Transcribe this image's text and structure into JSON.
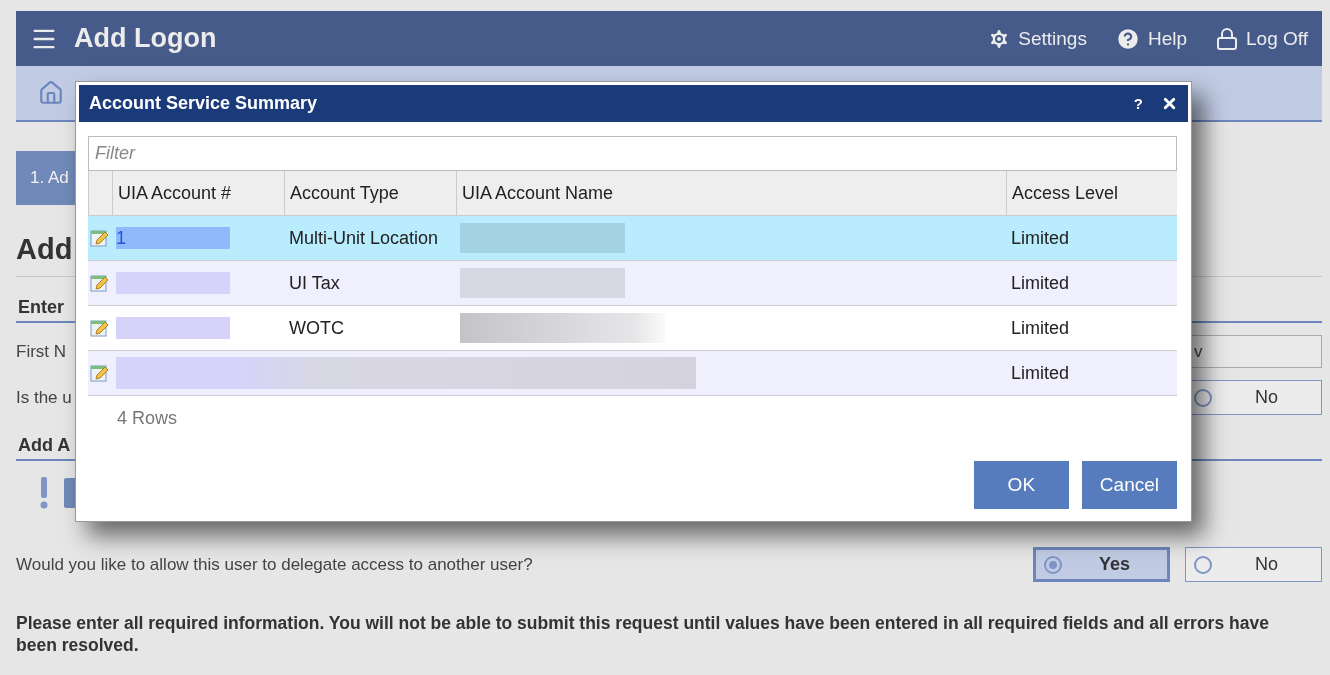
{
  "header": {
    "title": "Add Logon",
    "menu": [
      {
        "kind": "settings",
        "label": "Settings"
      },
      {
        "kind": "help",
        "label": "Help"
      },
      {
        "kind": "logoff",
        "label": "Log Off"
      }
    ]
  },
  "step": "1. Ad",
  "page": {
    "heading": "Add",
    "sections": [
      {
        "title": "Enter",
        "rows": [
          {
            "kind": "field",
            "label": "First N",
            "value": "v"
          },
          {
            "kind": "choice",
            "label": "Is the u",
            "options": [
              {
                "label": "No",
                "selected": false
              }
            ]
          }
        ]
      },
      {
        "title": "Add A",
        "rows": [
          {
            "kind": "alert"
          }
        ]
      }
    ],
    "delegate": {
      "question": "Would you like to allow this user to delegate access to another user?",
      "options": [
        {
          "label": "Yes",
          "selected": true
        },
        {
          "label": "No",
          "selected": false
        }
      ]
    },
    "notice": "Please enter all required information. You will not be able to submit this request until values have been entered in all required fields and all errors have been resolved."
  },
  "dialog": {
    "title": "Account Service Summary",
    "help": "?",
    "filter_placeholder": "Filter",
    "columns": [
      "UIA Account #",
      "Account Type",
      "UIA Account Name",
      "Access Level"
    ],
    "rows": [
      {
        "selected": true,
        "cells": [
          {
            "kind": "redacted",
            "text": "1"
          },
          {
            "kind": "text",
            "text": "Multi-Unit Location"
          },
          {
            "kind": "redacted"
          },
          {
            "kind": "text",
            "text": "Limited"
          }
        ]
      },
      {
        "selected": false,
        "cells": [
          {
            "kind": "redacted"
          },
          {
            "kind": "text",
            "text": "UI Tax"
          },
          {
            "kind": "redacted"
          },
          {
            "kind": "text",
            "text": "Limited"
          }
        ]
      },
      {
        "selected": false,
        "cells": [
          {
            "kind": "redacted"
          },
          {
            "kind": "text",
            "text": "WOTC"
          },
          {
            "kind": "redacted"
          },
          {
            "kind": "text",
            "text": "Limited"
          }
        ]
      },
      {
        "selected": false,
        "cells": [
          {
            "kind": "redacted-wide"
          },
          {
            "kind": "covered"
          },
          {
            "kind": "covered"
          },
          {
            "kind": "text",
            "text": "Limited"
          }
        ]
      }
    ],
    "row_count": "4 Rows",
    "buttons": [
      "OK",
      "Cancel"
    ]
  }
}
